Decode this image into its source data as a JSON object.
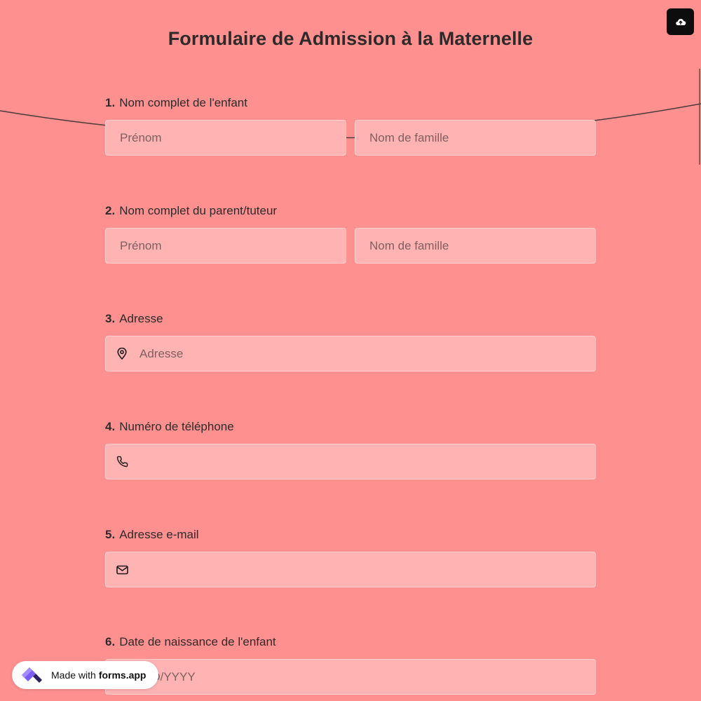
{
  "title": "Formulaire de Admission à la Maternelle",
  "save_icon": "cloud-upload-icon",
  "questions": [
    {
      "number": "1.",
      "label": "Nom complet de l'enfant",
      "fields": [
        {
          "placeholder": "Prénom",
          "value": ""
        },
        {
          "placeholder": "Nom de famille",
          "value": ""
        }
      ]
    },
    {
      "number": "2.",
      "label": "Nom complet du parent/tuteur",
      "fields": [
        {
          "placeholder": "Prénom",
          "value": ""
        },
        {
          "placeholder": "Nom de famille",
          "value": ""
        }
      ]
    },
    {
      "number": "3.",
      "label": "Adresse",
      "icon": "map-pin-icon",
      "field": {
        "placeholder": "Adresse",
        "value": ""
      }
    },
    {
      "number": "4.",
      "label": "Numéro de téléphone",
      "icon": "phone-icon",
      "field": {
        "placeholder": "",
        "value": ""
      }
    },
    {
      "number": "5.",
      "label": "Adresse e-mail",
      "icon": "mail-icon",
      "field": {
        "placeholder": "",
        "value": ""
      }
    },
    {
      "number": "6.",
      "label": "Date de naissance de l'enfant",
      "field": {
        "placeholder": "MM/DD/YYYY",
        "value": ""
      }
    }
  ],
  "badge": {
    "prefix": "Made with",
    "brand": "forms.app"
  },
  "colors": {
    "background": "#ff9090",
    "field_background": "#ffb3b3",
    "button_background": "#0d0d0d",
    "text": "#2e2a2a"
  }
}
